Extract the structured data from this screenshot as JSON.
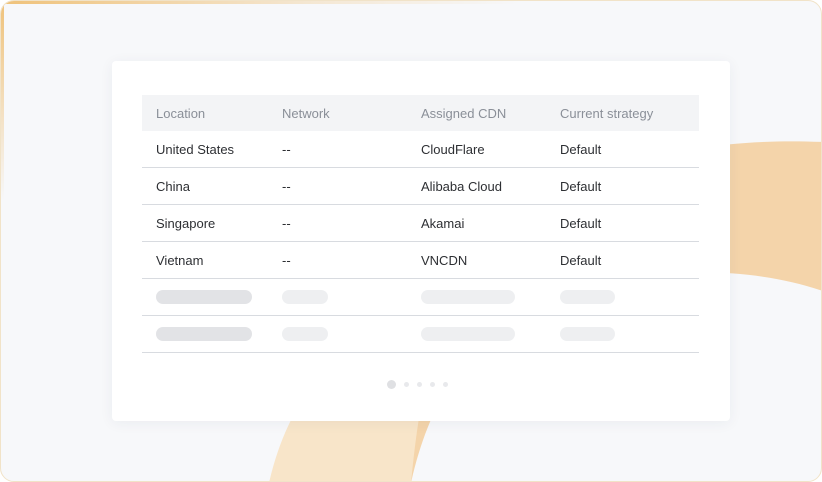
{
  "table": {
    "headers": [
      "Location",
      "Network",
      "Assigned CDN",
      "Current strategy"
    ],
    "rows": [
      [
        "United States",
        "--",
        "CloudFlare",
        "Default"
      ],
      [
        "China",
        "--",
        "Alibaba Cloud",
        "Default"
      ],
      [
        "Singapore",
        "--",
        "Akamai",
        "Default"
      ],
      [
        "Vietnam",
        "--",
        "VNCDN",
        "Default"
      ]
    ],
    "placeholder_rows": 2
  },
  "pagination": {
    "pages": 5,
    "current": 1
  },
  "colors": {
    "accent": "#f3d2a5",
    "background": "#f7f8fa",
    "card": "#ffffff"
  }
}
